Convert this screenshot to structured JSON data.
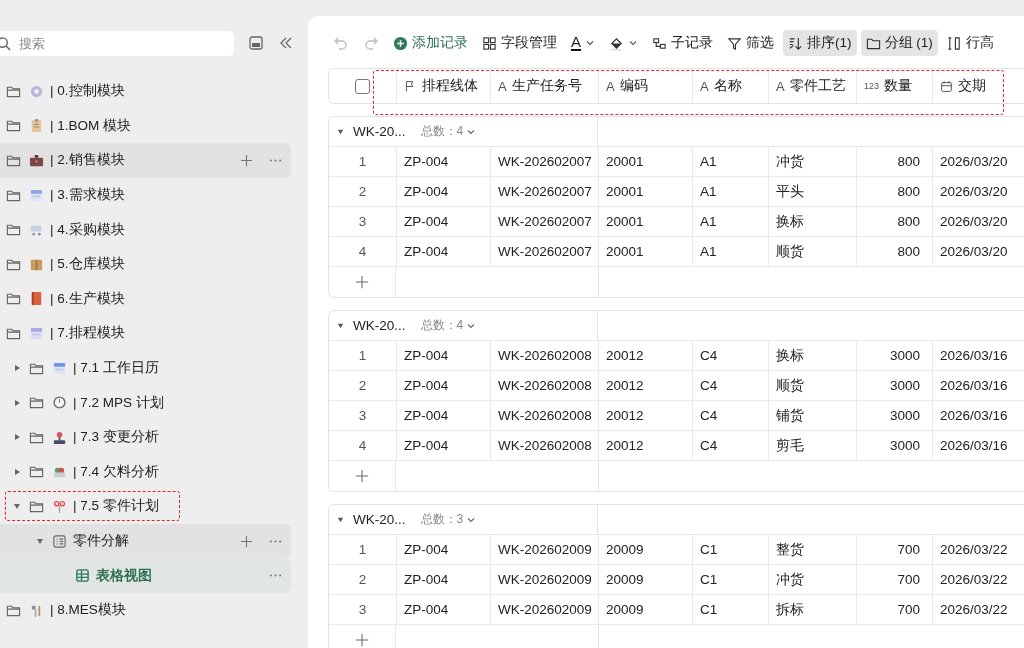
{
  "sidebar": {
    "search": {
      "placeholder": "搜索"
    },
    "items": [
      {
        "label": "| 0.控制模块",
        "kind": "folder",
        "highlighted": false,
        "selected": false,
        "marked": false
      },
      {
        "label": "| 1.BOM 模块",
        "kind": "folder",
        "highlighted": false,
        "selected": false,
        "marked": false
      },
      {
        "label": "| 2.销售模块",
        "kind": "folder",
        "highlighted": true,
        "selected": false,
        "marked": false
      },
      {
        "label": "| 3.需求模块",
        "kind": "folder",
        "highlighted": false,
        "selected": false,
        "marked": false
      },
      {
        "label": "| 4.采购模块",
        "kind": "folder",
        "highlighted": false,
        "selected": false,
        "marked": false
      },
      {
        "label": "| 5.仓库模块",
        "kind": "folder",
        "highlighted": false,
        "selected": false,
        "marked": false
      },
      {
        "label": "| 6.生产模块",
        "kind": "folder",
        "highlighted": false,
        "selected": false,
        "marked": false
      },
      {
        "label": "| 7.排程模块",
        "kind": "folder",
        "highlighted": false,
        "selected": false,
        "marked": false,
        "children": [
          {
            "label": "| 7.1 工作日历",
            "kind": "folder",
            "expanded": false,
            "highlighted": false,
            "selected": false,
            "marked": false
          },
          {
            "label": "| 7.2 MPS 计划",
            "kind": "folder",
            "expanded": false,
            "highlighted": false,
            "selected": false,
            "marked": false
          },
          {
            "label": "| 7.3 变更分析",
            "kind": "folder",
            "expanded": false,
            "highlighted": false,
            "selected": false,
            "marked": false
          },
          {
            "label": "| 7.4 欠料分析",
            "kind": "folder",
            "expanded": false,
            "highlighted": false,
            "selected": false,
            "marked": false
          },
          {
            "label": "| 7.5 零件计划",
            "kind": "folder",
            "expanded": true,
            "highlighted": false,
            "selected": false,
            "marked": true,
            "children": [
              {
                "label": "零件分解",
                "kind": "doc",
                "expanded": true,
                "highlighted": true,
                "selected": false,
                "marked": false,
                "children": [
                  {
                    "label": "表格视图",
                    "kind": "table",
                    "highlighted": false,
                    "selected": true,
                    "marked": false
                  }
                ]
              }
            ]
          }
        ]
      },
      {
        "label": "| 8.MES模块",
        "kind": "folder",
        "highlighted": false,
        "selected": false,
        "marked": false
      }
    ]
  },
  "toolbar": [
    {
      "kind": "undo",
      "disabled": true
    },
    {
      "kind": "redo",
      "disabled": true
    },
    {
      "kind": "add",
      "label": "添加记录",
      "active": false
    },
    {
      "kind": "fields",
      "label": "字段管理",
      "active": false
    },
    {
      "kind": "font-color",
      "label": "A",
      "active": false
    },
    {
      "kind": "fill-color",
      "active": false
    },
    {
      "kind": "subrecord",
      "label": "子记录",
      "active": false
    },
    {
      "kind": "filter",
      "label": "筛选",
      "active": false
    },
    {
      "kind": "sort",
      "label": "排序(1)",
      "active": true
    },
    {
      "kind": "group",
      "label": "分组 (1)",
      "active": true
    },
    {
      "kind": "row-height",
      "label": "行高",
      "active": false
    }
  ],
  "table": {
    "select_all": {
      "checked": false
    },
    "marked": true,
    "columns": [
      {
        "label": "排程线体",
        "kind": "flag"
      },
      {
        "label": "生产任务号",
        "kind": "text",
        "icon_text": "A"
      },
      {
        "label": "编码",
        "kind": "text",
        "icon_text": "A"
      },
      {
        "label": "名称",
        "kind": "text",
        "icon_text": "A"
      },
      {
        "label": "零件工艺",
        "kind": "text",
        "icon_text": "A"
      },
      {
        "label": "数量",
        "kind": "number",
        "icon_text": "123"
      },
      {
        "label": "交期",
        "kind": "date"
      }
    ],
    "groups": [
      {
        "title": "WK-20...",
        "count": "总数：4",
        "expanded": true,
        "rows": [
          {
            "num": "1",
            "cells": [
              "ZP-004",
              "WK-202602007",
              "20001",
              "A1",
              "冲货",
              "800",
              "2026/03/20"
            ]
          },
          {
            "num": "2",
            "cells": [
              "ZP-004",
              "WK-202602007",
              "20001",
              "A1",
              "平头",
              "800",
              "2026/03/20"
            ]
          },
          {
            "num": "3",
            "cells": [
              "ZP-004",
              "WK-202602007",
              "20001",
              "A1",
              "换标",
              "800",
              "2026/03/20"
            ]
          },
          {
            "num": "4",
            "cells": [
              "ZP-004",
              "WK-202602007",
              "20001",
              "A1",
              "顺货",
              "800",
              "2026/03/20"
            ]
          }
        ]
      },
      {
        "title": "WK-20...",
        "count": "总数：4",
        "expanded": true,
        "rows": [
          {
            "num": "1",
            "cells": [
              "ZP-004",
              "WK-202602008",
              "20012",
              "C4",
              "换标",
              "3000",
              "2026/03/16"
            ]
          },
          {
            "num": "2",
            "cells": [
              "ZP-004",
              "WK-202602008",
              "20012",
              "C4",
              "顺货",
              "3000",
              "2026/03/16"
            ]
          },
          {
            "num": "3",
            "cells": [
              "ZP-004",
              "WK-202602008",
              "20012",
              "C4",
              "铺货",
              "3000",
              "2026/03/16"
            ]
          },
          {
            "num": "4",
            "cells": [
              "ZP-004",
              "WK-202602008",
              "20012",
              "C4",
              "剪毛",
              "3000",
              "2026/03/16"
            ]
          }
        ]
      },
      {
        "title": "WK-20...",
        "count": "总数：3",
        "expanded": true,
        "rows": [
          {
            "num": "1",
            "cells": [
              "ZP-004",
              "WK-202602009",
              "20009",
              "C1",
              "整货",
              "700",
              "2026/03/22"
            ]
          },
          {
            "num": "2",
            "cells": [
              "ZP-004",
              "WK-202602009",
              "20009",
              "C1",
              "冲货",
              "700",
              "2026/03/22"
            ]
          },
          {
            "num": "3",
            "cells": [
              "ZP-004",
              "WK-202602009",
              "20009",
              "C1",
              "拆标",
              "700",
              "2026/03/22"
            ]
          }
        ]
      }
    ]
  }
}
